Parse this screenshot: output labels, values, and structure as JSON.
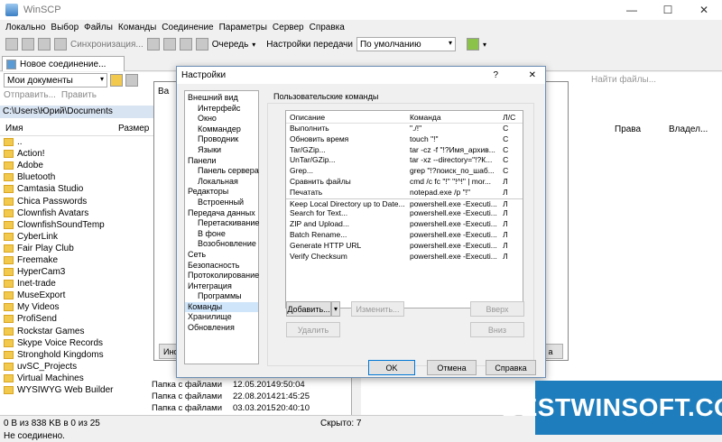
{
  "window": {
    "title": "WinSCP",
    "minimize": "—",
    "maximize": "☐",
    "close": "✕"
  },
  "menu": [
    "Локально",
    "Выбор",
    "Файлы",
    "Команды",
    "Соединение",
    "Параметры",
    "Сервер",
    "Справка"
  ],
  "toolbar": {
    "sync_label": "Синхронизация...",
    "queue_label": "Очередь",
    "transfer_settings_label": "Настройки передачи",
    "transfer_preset": "По умолчанию"
  },
  "tab": {
    "new_connection": "Новое соединение..."
  },
  "local": {
    "location": "Мои документы",
    "send_label": "Отправить...",
    "edit_label": "Править",
    "path": "C:\\Users\\Юрий\\Documents",
    "col_name": "Имя",
    "col_size": "Размер",
    "files": [
      "..",
      "Action!",
      "Adobe",
      "Bluetooth",
      "Camtasia Studio",
      "Chica Passwords",
      "Clownfish Avatars",
      "ClownfishSoundTemp",
      "CyberLink",
      "Fair Play Club",
      "Freemake",
      "HyperCam3",
      "Inet-trade",
      "MuseExport",
      "My Videos",
      "ProfiSend",
      "Rockstar Games",
      "Skype Voice Records",
      "Stronghold Kingdoms",
      "uvSC_Projects",
      "Virtual Machines",
      "WYSIWYG Web Builder"
    ],
    "bottom_rows": [
      {
        "type": "Папка с файлами",
        "date": "12.05.2014",
        "time": "9:50:04"
      },
      {
        "type": "Папка с файлами",
        "date": "22.08.2014",
        "time": "21:45:25"
      },
      {
        "type": "Папка с файлами",
        "date": "03.03.2015",
        "time": "20:40:10"
      }
    ]
  },
  "remote": {
    "find_files": "Найти файлы...",
    "col_rights": "Права",
    "col_owner": "Владел..."
  },
  "status": {
    "left": "0 B из 838 KB в 0 из 25",
    "hidden": "Скрыто: 7",
    "connection": "Не соединено."
  },
  "bg_dialog": {
    "title_fragment": "Ва",
    "inst_fragment": "Инст",
    "a_fragment": "а"
  },
  "settings_dialog": {
    "title": "Настройки",
    "help_glyph": "?",
    "close_glyph": "✕",
    "tree": [
      {
        "label": "Внешний вид",
        "level": 1
      },
      {
        "label": "Интерфейс",
        "level": 2
      },
      {
        "label": "Окно",
        "level": 2
      },
      {
        "label": "Коммандер",
        "level": 2
      },
      {
        "label": "Проводник",
        "level": 2
      },
      {
        "label": "Языки",
        "level": 2
      },
      {
        "label": "Панели",
        "level": 1
      },
      {
        "label": "Панель сервера",
        "level": 2
      },
      {
        "label": "Локальная",
        "level": 2
      },
      {
        "label": "Редакторы",
        "level": 1
      },
      {
        "label": "Встроенный",
        "level": 2
      },
      {
        "label": "Передача данных",
        "level": 1
      },
      {
        "label": "Перетаскивание",
        "level": 2
      },
      {
        "label": "В фоне",
        "level": 2
      },
      {
        "label": "Возобновление",
        "level": 2
      },
      {
        "label": "Сеть",
        "level": 1
      },
      {
        "label": "Безопасность",
        "level": 1
      },
      {
        "label": "Протоколирование",
        "level": 1
      },
      {
        "label": "Интеграция",
        "level": 1
      },
      {
        "label": "Программы",
        "level": 2
      },
      {
        "label": "Команды",
        "level": 1,
        "selected": true
      },
      {
        "label": "Хранилище",
        "level": 1
      },
      {
        "label": "Обновления",
        "level": 1
      }
    ],
    "group_label": "Пользовательские команды",
    "table_headers": {
      "description": "Описание",
      "command": "Команда",
      "ls": "Л/С"
    },
    "commands": [
      {
        "desc": "Выполнить",
        "cmd": "\"./!\"",
        "ls": "С"
      },
      {
        "desc": "Обновить время",
        "cmd": "touch \"!\"",
        "ls": "С"
      },
      {
        "desc": "Tar/GZip...",
        "cmd": "tar -cz -f \"!?Имя_архив...",
        "ls": "С"
      },
      {
        "desc": "UnTar/GZip...",
        "cmd": "tar -xz --directory=\"!?К...",
        "ls": "С"
      },
      {
        "desc": "Grep...",
        "cmd": "grep \"!?поиск_по_шаб...",
        "ls": "С"
      },
      {
        "desc": "Сравнить файлы",
        "cmd": "cmd /c fc \"!\" \"!^!\" | mor...",
        "ls": "Л"
      },
      {
        "desc": "Печатать",
        "cmd": "notepad.exe /p \"!\"",
        "ls": "Л"
      },
      {
        "desc": "Keep Local Directory up to Date...",
        "cmd": "powershell.exe -Executi...",
        "ls": "Л",
        "sep": true
      },
      {
        "desc": "Search for Text...",
        "cmd": "powershell.exe -Executi...",
        "ls": "Л"
      },
      {
        "desc": "ZIP and Upload...",
        "cmd": "powershell.exe -Executi...",
        "ls": "Л"
      },
      {
        "desc": "Batch Rename...",
        "cmd": "powershell.exe -Executi...",
        "ls": "Л"
      },
      {
        "desc": "Generate HTTP URL",
        "cmd": "powershell.exe -Executi...",
        "ls": "Л"
      },
      {
        "desc": "Verify Checksum",
        "cmd": "powershell.exe -Executi...",
        "ls": "Л"
      }
    ],
    "buttons": {
      "add": "Добавить...",
      "edit": "Изменить...",
      "delete": "Удалить",
      "up": "Вверх",
      "down": "Вниз",
      "ok": "OK",
      "cancel": "Отмена",
      "help": "Справка"
    }
  },
  "watermark": "BESTWINSOFT.COM"
}
